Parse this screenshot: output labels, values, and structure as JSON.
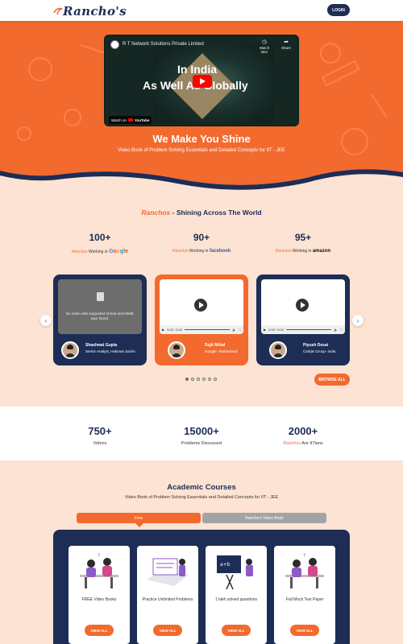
{
  "header": {
    "logo_text": "Rancho's",
    "login_label": "LOGIN"
  },
  "video": {
    "channel": "R T Network Solutions Private Limited",
    "watch_later": "Watch later",
    "share": "Share",
    "headline_line1": "In India",
    "headline_line2": "As Well As Globally",
    "watch_on": "Watch on",
    "youtube": "YouTube"
  },
  "hero": {
    "title": "We Make You Shine",
    "subtitle": "Video Book of Problem Solving Essentials and Detailed Concepts for IIT - JEE"
  },
  "shining": {
    "title_brand": "Ranchos",
    "title_rest": " - Shining Across The World",
    "stats": [
      {
        "value": "100+",
        "brand": "Ranchos",
        "text": " Working in ",
        "company": "Google"
      },
      {
        "value": "90+",
        "brand": "Ranchos",
        "text": " Working in ",
        "company": "facebook"
      },
      {
        "value": "95+",
        "brand": "Ranchos",
        "text": " Working in ",
        "company": "amazon"
      }
    ]
  },
  "testimonials": [
    {
      "error": "No video with supported format and MIME type found.",
      "name": "Shashwat Gupta",
      "role": "Senior Analyst, Hokman Sachs"
    },
    {
      "time": "0:00 / 0:00",
      "name": "Sujit Mittal",
      "role": "Google- Switzerland"
    },
    {
      "time": "0:00 / 0:00",
      "name": "Piyush Desai",
      "role": "Carlyle Group- India"
    }
  ],
  "browse_label": "BROWSE ALL",
  "counts": [
    {
      "value": "750+",
      "label": "Videos"
    },
    {
      "value": "15000+",
      "label": "Problems Discussed"
    },
    {
      "value": "2000+",
      "brand": "Ranchos",
      "label": " Are IITians"
    }
  ],
  "courses": {
    "title": "Academic Courses",
    "subtitle": "Video Book of Problem Solving Essentials and Detailed Concepts for IIT - JEE",
    "tabs": [
      "Free",
      "Rancho's Video Book"
    ],
    "cards": [
      {
        "label": "FREE Video Books",
        "button": "VIEW ALL"
      },
      {
        "label": "Practice Unlimited Problems",
        "button": "VIEW ALL"
      },
      {
        "label": "1 lakh solved questions",
        "button": "VIEW ALL"
      },
      {
        "label": "Full Mock Test Paper",
        "button": "VIEW ALL"
      }
    ]
  },
  "colors": {
    "navy": "#1d2d55",
    "orange": "#f26a2e",
    "peach": "#fde3d3"
  }
}
